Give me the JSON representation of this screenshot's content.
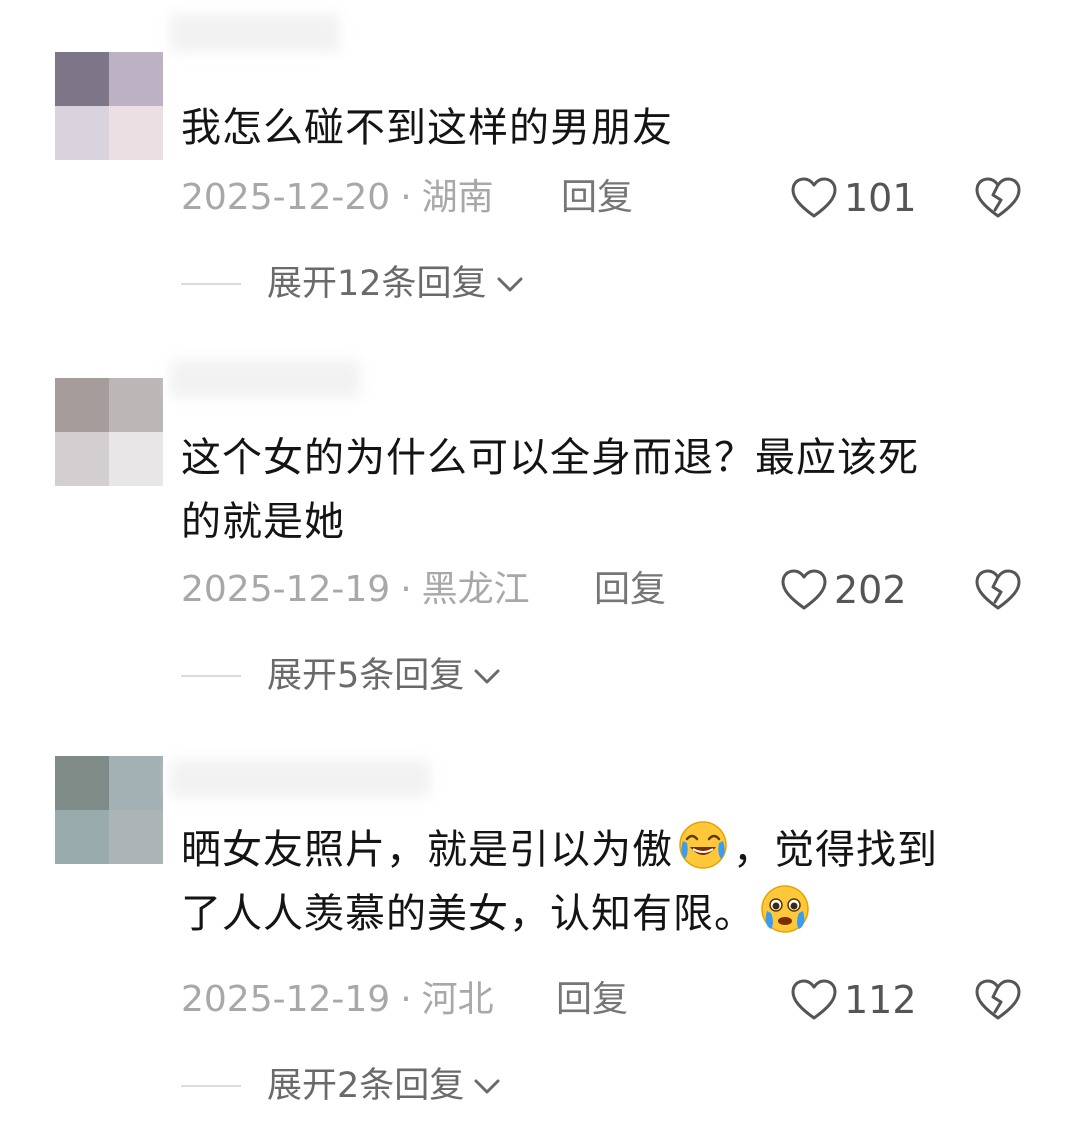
{
  "comments": [
    {
      "text_lines": [
        "我怎么碰不到这样的男朋友"
      ],
      "date": "2025-12-20",
      "separator": "·",
      "location": "湖南",
      "reply_label": "回复",
      "likes": "101",
      "expand_label": "展开12条回复"
    },
    {
      "text_lines": [
        "这个女的为什么可以全身而退？最应该死",
        "的就是她"
      ],
      "date": "2025-12-19",
      "separator": "·",
      "location": "黑龙江",
      "reply_label": "回复",
      "likes": "202",
      "expand_label": "展开5条回复"
    },
    {
      "text_a": "晒女友照片，就是引以为傲",
      "text_b": "，觉得找到",
      "text_c": "了人人羡慕的美女，认知有限。",
      "emojis": [
        "laughing-crying-emoji",
        "pleading-teary-emoji"
      ],
      "date": "2025-12-19",
      "separator": "·",
      "location": "河北",
      "reply_label": "回复",
      "likes": "112",
      "expand_label": "展开2条回复"
    }
  ],
  "icons": {
    "like": "heart-outline-icon",
    "dislike": "broken-heart-icon",
    "expand": "chevron-down-icon"
  },
  "colors": {
    "text": "#141414",
    "meta": "#a8a8a8",
    "reply": "#767676",
    "count": "#555555",
    "divider": "#dcdcdc"
  }
}
